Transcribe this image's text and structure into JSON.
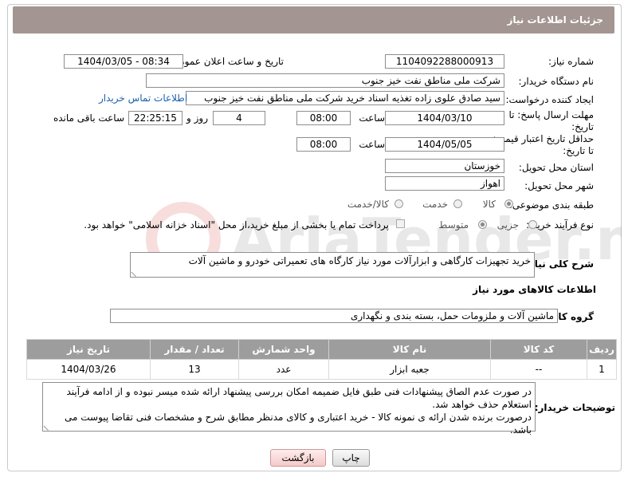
{
  "header": {
    "title": "جزئیات اطلاعات نیاز"
  },
  "form": {
    "need_number_label": "شماره نیاز:",
    "need_number": "1104092288000913",
    "announce_label": "تاریخ و ساعت اعلان عمومی:",
    "announce_value": "1404/03/05 - 08:34",
    "buyer_org_label": "نام دستگاه خریدار:",
    "buyer_org": "شرکت ملی مناطق نفت خیز جنوب",
    "creator_label": "ایجاد کننده درخواست:",
    "creator": "سید صادق علوی زاده  تغذیه اسناد خرید  شرکت ملی مناطق نفت خیز جنوب",
    "contact_link": "اطلاعات تماس خریدار",
    "deadline_label_1": "مهلت ارسال پاسخ: تا",
    "deadline_label_2": "تاریخ:",
    "deadline_date": "1404/03/10",
    "time_label": "ساعت",
    "deadline_time": "08:00",
    "days_value": "4",
    "days_label": "روز و",
    "remaining_time": "22:25:15",
    "remaining_label": "ساعت باقی مانده",
    "validity_label_1": "حداقل تاریخ اعتبار قیمت:",
    "validity_label_2": "تا تاریخ:",
    "validity_date": "1404/05/05",
    "validity_time": "08:00",
    "province_label": "استان محل تحویل:",
    "province": "خوزستان",
    "city_label": "شهر محل تحویل:",
    "city": "اهواز",
    "category_label": "طبقه بندی موضوعی:",
    "category_options": [
      "کالا",
      "خدمت",
      "کالا/خدمت"
    ],
    "process_label": "نوع فرآیند خرید :",
    "process_options": [
      "جزیی",
      "متوسط"
    ],
    "payment_note": "پرداخت تمام یا بخشی از مبلغ خرید،از محل \"اسناد خزانه اسلامی\" خواهد بود.",
    "description_label": "شرح کلی نیاز:",
    "description": "خرید تجهیزات کارگاهی و ابزارآلات مورد نیاز کارگاه های تعمیراتی خودرو و ماشین آلات",
    "goods_info_title": "اطلاعات کالاهای مورد نیاز",
    "goods_group_label": "گروه کالا:",
    "goods_group": "ماشین آلات و ملزومات حمل، بسته بندی و نگهداری"
  },
  "table": {
    "headers": [
      "ردیف",
      "کد کالا",
      "نام کالا",
      "واحد شمارش",
      "تعداد / مقدار",
      "تاریخ نیاز"
    ],
    "rows": [
      [
        "1",
        "--",
        "جعبه ابزار",
        "عدد",
        "13",
        "1404/03/26"
      ]
    ]
  },
  "notes": {
    "label": "توضیحات خریدار:",
    "line1": "در صورت عدم الصاق پیشنهادات فنی طبق فایل ضمیمه امکان بررسی پیشنهاد ارائه شده میسر نبوده و از ادامه فرآیند",
    "line2": "استعلام حذف خواهد شد.",
    "line3": "درصورت برنده شدن ارائه ی نمونه کالا - خرید اعتباری و کالای مدنظر مطابق شرح و مشخصات فنی تقاضا پیوست می باشد."
  },
  "buttons": {
    "print": "چاپ",
    "back": "بازگشت"
  },
  "watermark": {
    "text": "AriaTender.net"
  },
  "colors": {
    "header_bg": "#a39591",
    "table_header_bg": "#9d9d9d",
    "link": "#1b5fb0"
  }
}
